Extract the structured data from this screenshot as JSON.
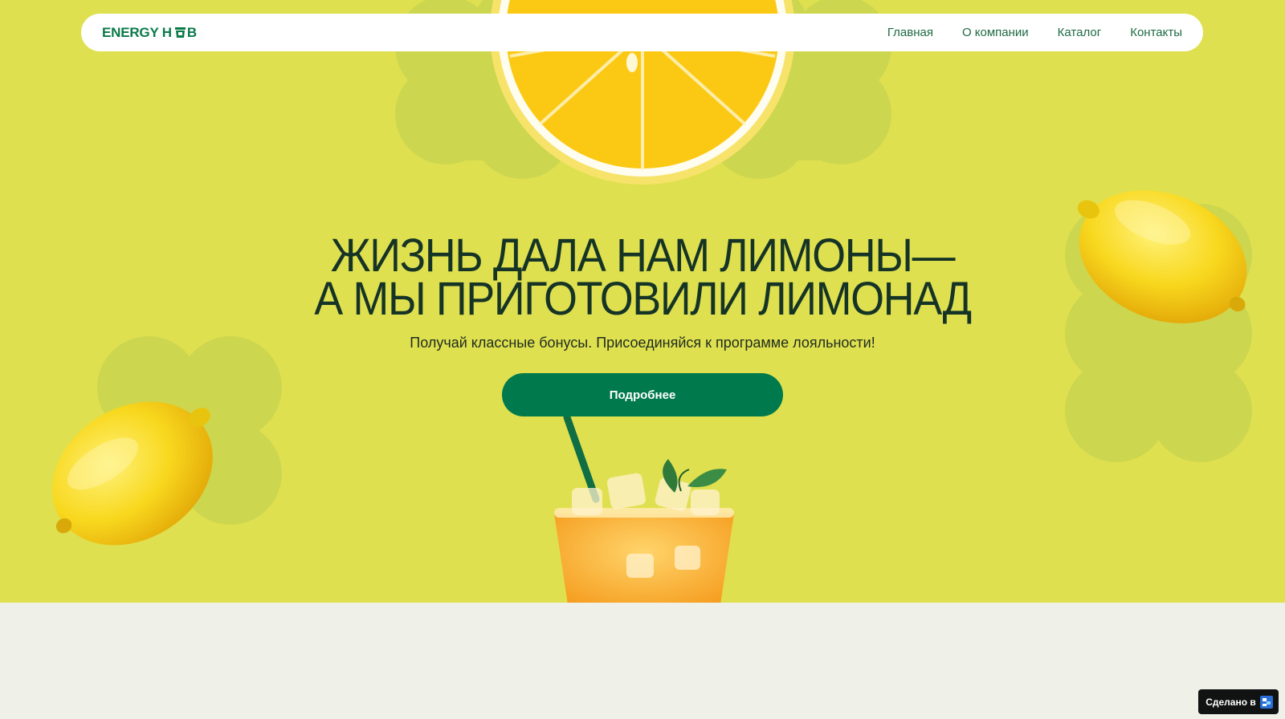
{
  "brand": {
    "name_part1": "ENERGY H",
    "name_part2": "B"
  },
  "nav": {
    "items": [
      {
        "label": "Главная"
      },
      {
        "label": "О компании"
      },
      {
        "label": "Каталог"
      },
      {
        "label": "Контакты"
      }
    ]
  },
  "hero": {
    "headline_line1": "ЖИЗНЬ ДАЛА НАМ ЛИМОНЫ—",
    "headline_line2": "А МЫ ПРИГОТОВИЛИ ЛИМОНАД",
    "subtitle": "Получай классные бонусы. Присоединяйся к программе лояльности!",
    "cta_label": "Подробнее"
  },
  "badge": {
    "label": "Сделано в"
  },
  "colors": {
    "hero_background": "#dfe04f",
    "brand_green": "#007a4d",
    "page_background": "#eff0e8"
  }
}
